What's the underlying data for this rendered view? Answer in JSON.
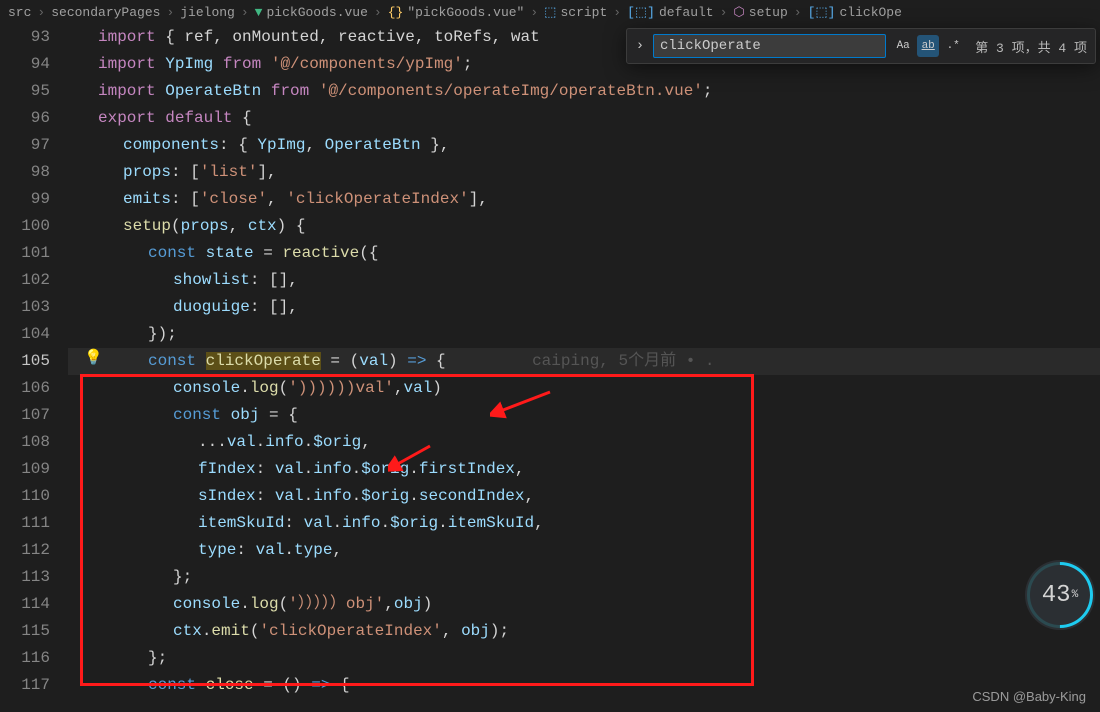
{
  "breadcrumb": {
    "src": "src",
    "sp": "secondaryPages",
    "jl": "jielong",
    "file": "pickGoods.vue",
    "file2": "\"pickGoods.vue\"",
    "script": "script",
    "default": "default",
    "setup": "setup",
    "method": "clickOpe"
  },
  "search": {
    "value": "clickOperate",
    "count": "第 3 项，共 4 项"
  },
  "gutter": [
    "93",
    "94",
    "95",
    "96",
    "97",
    "98",
    "99",
    "100",
    "101",
    "102",
    "103",
    "104",
    "105",
    "106",
    "107",
    "108",
    "109",
    "110",
    "111",
    "112",
    "113",
    "114",
    "115",
    "116",
    "117"
  ],
  "activeLine": "105",
  "code": [
    {
      "pad": 0,
      "t": [
        {
          "c": "kw",
          "v": "import "
        },
        {
          "c": "pl",
          "v": "{ ref, onMounted, reactive, toRefs, wat"
        }
      ]
    },
    {
      "pad": 0,
      "t": [
        {
          "c": "kw",
          "v": "import "
        },
        {
          "c": "var",
          "v": "YpImg"
        },
        {
          "c": "kw",
          "v": " from "
        },
        {
          "c": "str",
          "v": "'@/components/ypImg'"
        },
        {
          "c": "pl",
          "v": ";"
        }
      ]
    },
    {
      "pad": 0,
      "t": [
        {
          "c": "kw",
          "v": "import "
        },
        {
          "c": "var",
          "v": "OperateBtn"
        },
        {
          "c": "kw",
          "v": " from "
        },
        {
          "c": "str",
          "v": "'@/components/operateImg/operateBtn.vue'"
        },
        {
          "c": "pl",
          "v": ";"
        }
      ]
    },
    {
      "pad": 0,
      "t": [
        {
          "c": "kw",
          "v": "export default "
        },
        {
          "c": "pl",
          "v": "{"
        }
      ]
    },
    {
      "pad": 1,
      "t": [
        {
          "c": "var",
          "v": "components"
        },
        {
          "c": "pl",
          "v": ": { "
        },
        {
          "c": "var",
          "v": "YpImg"
        },
        {
          "c": "pl",
          "v": ", "
        },
        {
          "c": "var",
          "v": "OperateBtn"
        },
        {
          "c": "pl",
          "v": " },"
        }
      ]
    },
    {
      "pad": 1,
      "t": [
        {
          "c": "var",
          "v": "props"
        },
        {
          "c": "pl",
          "v": ": ["
        },
        {
          "c": "str",
          "v": "'list'"
        },
        {
          "c": "pl",
          "v": "],"
        }
      ]
    },
    {
      "pad": 1,
      "t": [
        {
          "c": "var",
          "v": "emits"
        },
        {
          "c": "pl",
          "v": ": ["
        },
        {
          "c": "str",
          "v": "'close'"
        },
        {
          "c": "pl",
          "v": ", "
        },
        {
          "c": "str",
          "v": "'clickOperateIndex'"
        },
        {
          "c": "pl",
          "v": "],"
        }
      ]
    },
    {
      "pad": 1,
      "t": [
        {
          "c": "fn",
          "v": "setup"
        },
        {
          "c": "pl",
          "v": "("
        },
        {
          "c": "var",
          "v": "props"
        },
        {
          "c": "pl",
          "v": ", "
        },
        {
          "c": "var",
          "v": "ctx"
        },
        {
          "c": "pl",
          "v": ") {"
        }
      ]
    },
    {
      "pad": 2,
      "t": [
        {
          "c": "kw2",
          "v": "const "
        },
        {
          "c": "var",
          "v": "state"
        },
        {
          "c": "pl",
          "v": " = "
        },
        {
          "c": "fn",
          "v": "reactive"
        },
        {
          "c": "pl",
          "v": "({"
        }
      ]
    },
    {
      "pad": 3,
      "t": [
        {
          "c": "var",
          "v": "showlist"
        },
        {
          "c": "pl",
          "v": ": [],"
        }
      ]
    },
    {
      "pad": 3,
      "t": [
        {
          "c": "var",
          "v": "duoguige"
        },
        {
          "c": "pl",
          "v": ": [],"
        }
      ]
    },
    {
      "pad": 2,
      "t": [
        {
          "c": "pl",
          "v": "});"
        }
      ]
    },
    {
      "pad": 2,
      "active": true,
      "t": [
        {
          "c": "kw2",
          "v": "const "
        },
        {
          "c": "fn hl",
          "v": "clickOperate"
        },
        {
          "c": "pl",
          "v": " = ("
        },
        {
          "c": "var",
          "v": "val"
        },
        {
          "c": "pl",
          "v": ") "
        },
        {
          "c": "kw2",
          "v": "=>"
        },
        {
          "c": "pl",
          "v": " {         "
        },
        {
          "c": "gh",
          "v": "caiping, 5个月前 • ."
        }
      ]
    },
    {
      "pad": 3,
      "t": [
        {
          "c": "var",
          "v": "console"
        },
        {
          "c": "pl",
          "v": "."
        },
        {
          "c": "fn",
          "v": "log"
        },
        {
          "c": "pl",
          "v": "("
        },
        {
          "c": "str",
          "v": "'))))))val'"
        },
        {
          "c": "pl",
          "v": ","
        },
        {
          "c": "var",
          "v": "val"
        },
        {
          "c": "pl",
          "v": ")"
        }
      ]
    },
    {
      "pad": 3,
      "t": [
        {
          "c": "kw2",
          "v": "const "
        },
        {
          "c": "var",
          "v": "obj"
        },
        {
          "c": "pl",
          "v": " = {"
        }
      ]
    },
    {
      "pad": 4,
      "t": [
        {
          "c": "pl",
          "v": "..."
        },
        {
          "c": "var",
          "v": "val"
        },
        {
          "c": "pl",
          "v": "."
        },
        {
          "c": "var",
          "v": "info"
        },
        {
          "c": "pl",
          "v": "."
        },
        {
          "c": "var",
          "v": "$orig"
        },
        {
          "c": "pl",
          "v": ","
        }
      ]
    },
    {
      "pad": 4,
      "t": [
        {
          "c": "var",
          "v": "fIndex"
        },
        {
          "c": "pl",
          "v": ": "
        },
        {
          "c": "var",
          "v": "val"
        },
        {
          "c": "pl",
          "v": "."
        },
        {
          "c": "var",
          "v": "info"
        },
        {
          "c": "pl",
          "v": "."
        },
        {
          "c": "var",
          "v": "$orig"
        },
        {
          "c": "pl",
          "v": "."
        },
        {
          "c": "var",
          "v": "firstIndex"
        },
        {
          "c": "pl",
          "v": ","
        }
      ]
    },
    {
      "pad": 4,
      "t": [
        {
          "c": "var",
          "v": "sIndex"
        },
        {
          "c": "pl",
          "v": ": "
        },
        {
          "c": "var",
          "v": "val"
        },
        {
          "c": "pl",
          "v": "."
        },
        {
          "c": "var",
          "v": "info"
        },
        {
          "c": "pl",
          "v": "."
        },
        {
          "c": "var",
          "v": "$orig"
        },
        {
          "c": "pl",
          "v": "."
        },
        {
          "c": "var",
          "v": "secondIndex"
        },
        {
          "c": "pl",
          "v": ","
        }
      ]
    },
    {
      "pad": 4,
      "t": [
        {
          "c": "var",
          "v": "itemSkuId"
        },
        {
          "c": "pl",
          "v": ": "
        },
        {
          "c": "var",
          "v": "val"
        },
        {
          "c": "pl",
          "v": "."
        },
        {
          "c": "var",
          "v": "info"
        },
        {
          "c": "pl",
          "v": "."
        },
        {
          "c": "var",
          "v": "$orig"
        },
        {
          "c": "pl",
          "v": "."
        },
        {
          "c": "var",
          "v": "itemSkuId"
        },
        {
          "c": "pl",
          "v": ","
        }
      ]
    },
    {
      "pad": 4,
      "t": [
        {
          "c": "var",
          "v": "type"
        },
        {
          "c": "pl",
          "v": ": "
        },
        {
          "c": "var",
          "v": "val"
        },
        {
          "c": "pl",
          "v": "."
        },
        {
          "c": "var",
          "v": "type"
        },
        {
          "c": "pl",
          "v": ","
        }
      ]
    },
    {
      "pad": 3,
      "t": [
        {
          "c": "pl",
          "v": "};"
        }
      ]
    },
    {
      "pad": 3,
      "t": [
        {
          "c": "var",
          "v": "console"
        },
        {
          "c": "pl",
          "v": "."
        },
        {
          "c": "fn",
          "v": "log"
        },
        {
          "c": "pl",
          "v": "("
        },
        {
          "c": "str",
          "v": "'）））））obj'"
        },
        {
          "c": "pl",
          "v": ","
        },
        {
          "c": "var",
          "v": "obj"
        },
        {
          "c": "pl",
          "v": ")"
        }
      ]
    },
    {
      "pad": 3,
      "t": [
        {
          "c": "var",
          "v": "ctx"
        },
        {
          "c": "pl",
          "v": "."
        },
        {
          "c": "fn",
          "v": "emit"
        },
        {
          "c": "pl",
          "v": "("
        },
        {
          "c": "str",
          "v": "'clickOperateIndex'"
        },
        {
          "c": "pl",
          "v": ", "
        },
        {
          "c": "var",
          "v": "obj"
        },
        {
          "c": "pl",
          "v": ");"
        }
      ]
    },
    {
      "pad": 2,
      "t": [
        {
          "c": "pl",
          "v": "};"
        }
      ]
    },
    {
      "pad": 2,
      "t": [
        {
          "c": "kw2",
          "v": "const "
        },
        {
          "c": "fn",
          "v": "close"
        },
        {
          "c": "pl",
          "v": " = () "
        },
        {
          "c": "kw2",
          "v": "=>"
        },
        {
          "c": "pl",
          "v": " {"
        }
      ]
    }
  ],
  "badge": {
    "value": "43",
    "pct": "%"
  },
  "watermark": "CSDN @Baby-King"
}
